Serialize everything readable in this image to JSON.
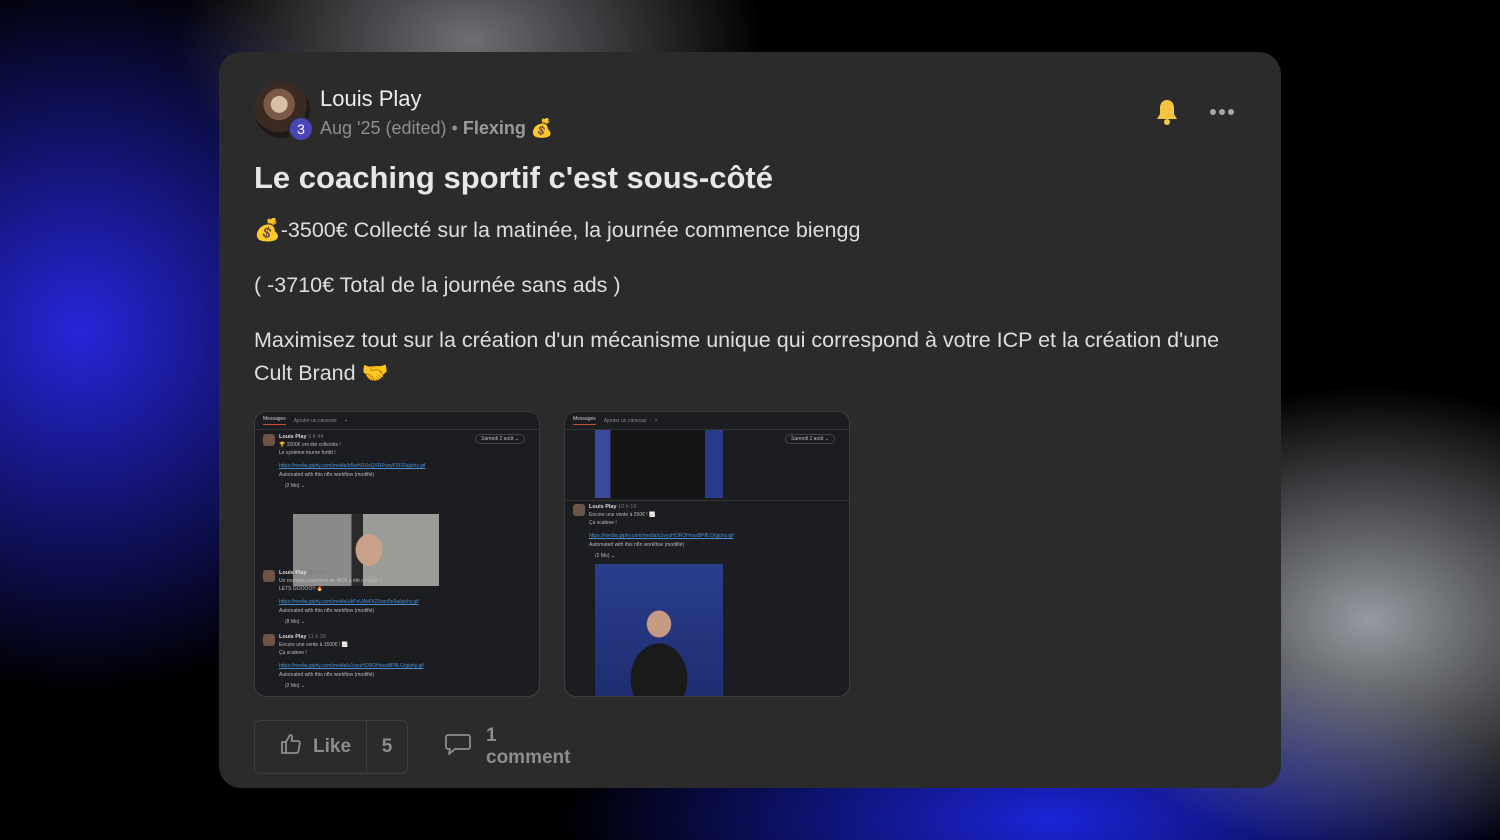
{
  "post": {
    "author": "Louis Play",
    "level": "3",
    "date": "Aug '25 (edited)",
    "separator": "•",
    "category": "Flexing 💰",
    "title": "Le coaching sportif c'est sous-côté",
    "paragraphs": [
      "💰-3500€ Collecté sur la matinée, la journée commence biengg",
      "( -3710€ Total de la journée sans ads )",
      "Maximisez tout sur la création d'un mécanisme unique qui correspond à votre ICP et la création d'une Cult Brand 🤝"
    ],
    "icons": {
      "notify": "bell-icon",
      "more": "more-options-icon",
      "like": "thumbs-up-icon",
      "comment": "comment-bubble-icon"
    },
    "colors": {
      "card": "#2b2b2b",
      "badge": "#4b46b8",
      "bell": "#f5c542",
      "link": "#4b8fd6"
    }
  },
  "attachments": {
    "tabs": [
      "Messages",
      "Ajouter un canevas",
      "+"
    ],
    "date_pill": "Samedi 2 août ⌄",
    "shot1": {
      "msgs": [
        {
          "who": "Louis Play",
          "time": "9 h 44",
          "lines": [
            "🏆 1500€ ont été collectés !",
            "Le système tourne fortttt !"
          ],
          "link": "https://media.giphy.com/media/b5wHOUsQXRPusyP2FO/giphy.gif",
          "auto": "Automated with this n8n workflow (modifié)",
          "size": "(2 Mo) ⌄"
        },
        {
          "who": "Louis Play",
          "time": "10 h 37",
          "lines": [
            "Un nouveau paiement de 460€ a été collecté !",
            "LETS GOOOO!! 🔥"
          ],
          "link": "https://media.giphy.com/media/ukPeUAbFlt22sxn5n9a/giphy.gif",
          "auto": "Automated with this n8n workflow (modifié)",
          "size": "(8 Mo) ⌄"
        },
        {
          "who": "Louis Play",
          "time": "11 h 33",
          "lines": [
            "Encore une vente à 1500€ ! 📈",
            "Ça scaleee !"
          ],
          "link": "https://media.giphy.com/media/u1vyuHOROHnxaBP8LO/giphy.gif",
          "auto": "Automated with this n8n workflow (modifié)",
          "size": "(2 Mo) ⌄"
        }
      ]
    },
    "shot2": {
      "msgs": [
        {
          "who": "Louis Play",
          "time": "10 h 19",
          "lines": [
            "Encore une vente à 250€ ! 📈",
            "Ça scaleee !"
          ],
          "link": "https://media.giphy.com/media/u1vyuHOROHnxaBP8LO/giphy.gif",
          "auto": "Automated with this n8n workflow (modifié)",
          "size": "(2 Mo) ⌄"
        }
      ]
    }
  },
  "actions": {
    "like_label": "Like",
    "like_count": "5",
    "comment_label": "1 comment"
  }
}
